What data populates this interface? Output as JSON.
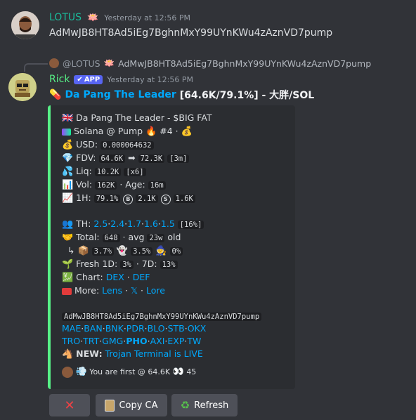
{
  "message1": {
    "author": "LOTUS",
    "author_emoji": "🪷",
    "timestamp": "Yesterday at 12:56 PM",
    "text": "AdMwJB8HT8Ad5iEg7BghnMxY99UYnKWu4zAznVD7pump"
  },
  "reply": {
    "mention": "@LOTUS",
    "emoji": "🪷",
    "text": "AdMwJB8HT8Ad5iEg7BghnMxY99UYnKWu4zAznVD7pump"
  },
  "message2": {
    "author": "Rick",
    "badge": "APP",
    "timestamp": "Yesterday at 12:56 PM",
    "title_emoji": "💊",
    "title_name": "Da Pang The Leader",
    "title_stats": "[64.6K/79.1%] - 大胖/SOL"
  },
  "embed": {
    "token_line": "Da Pang The Leader - $BIG FAT",
    "chain": "Solana @ Pump",
    "rank": "#4",
    "usd_label": "USD:",
    "usd": "0.000064632",
    "fdv_label": "FDV:",
    "fdv_from": "64.6K",
    "fdv_to": "72.3K",
    "fdv_time": "[3m]",
    "liq_label": "Liq:",
    "liq": "10.2K",
    "liq_mult": "[x6]",
    "vol_label": "Vol:",
    "vol": "162K",
    "age_label": "Age:",
    "age": "16m",
    "h1_label": "1H:",
    "h1_pct": "79.1%",
    "h1_buys": "2.1K",
    "h1_sells": "1.6K",
    "th_label": "TH:",
    "th_values": [
      "2.5",
      "2.4",
      "1.7",
      "1.6",
      "1.5"
    ],
    "th_total": "[16%]",
    "total_label": "Total:",
    "total_count": "648",
    "avg_label": "avg",
    "avg_value": "23w",
    "old_label": "old",
    "pct_a": "3.7%",
    "pct_b": "3.5%",
    "pct_c": "0%",
    "fresh_label": "Fresh 1D:",
    "fresh_1d": "3%",
    "fresh_7d_label": "7D:",
    "fresh_7d": "13%",
    "chart_label": "Chart:",
    "chart_links": [
      "DEX",
      "DEF"
    ],
    "more_label": "More:",
    "more_links": [
      "Lens",
      "𝕏",
      "Lore"
    ],
    "contract": "AdMwJB8HT8Ad5iEg7BghnMxY99UYnKWu4zAznVD7pump",
    "exchanges_row1": [
      "MAE",
      "BAN",
      "BNK",
      "PDR",
      "BLO",
      "STB",
      "OKX"
    ],
    "exchanges_row2": [
      "TRO",
      "TRT",
      "GMG",
      "PHO",
      "AXI",
      "EXP",
      "TW"
    ],
    "new_label": "NEW:",
    "new_link": "Trojan Terminal is LIVE",
    "footer_text": "You are first @ 64.6K",
    "footer_count": "45"
  },
  "buttons": {
    "copy_label": "Copy CA",
    "refresh_label": "Refresh"
  },
  "colors": {
    "background": "#313338",
    "embed_bg": "#2b2d31",
    "embed_border": "#57f287",
    "link": "#00a8fc",
    "lotus_name": "#1abc9c",
    "rick_name": "#57f287",
    "app_badge": "#5865f2",
    "title_link": "#00a8fc"
  }
}
